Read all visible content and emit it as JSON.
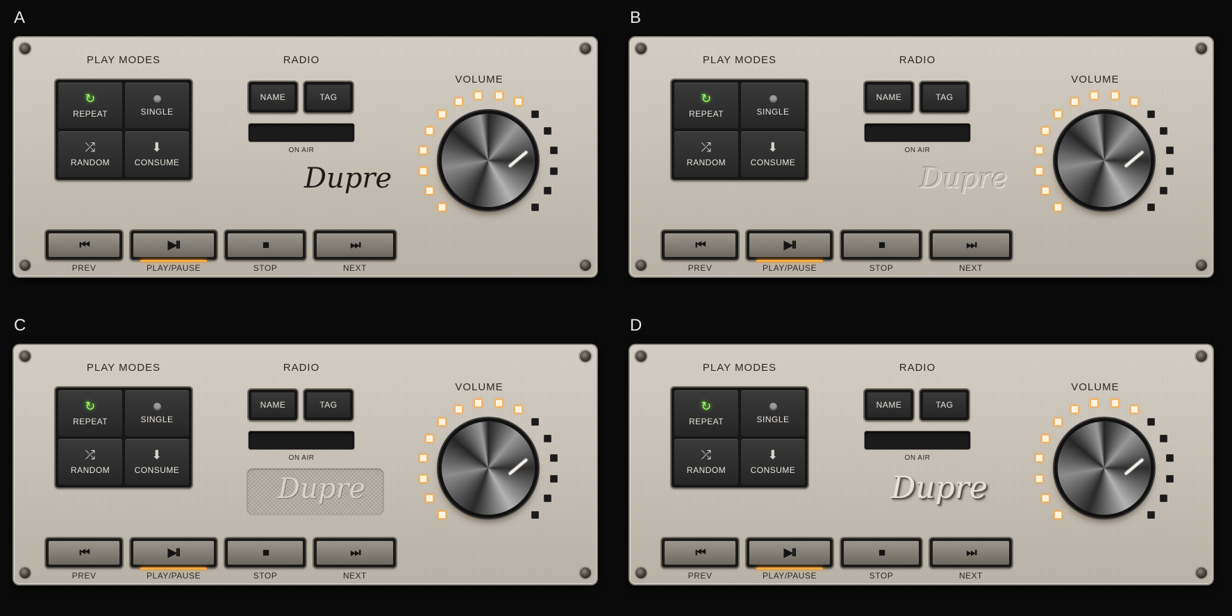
{
  "variants": [
    {
      "label": "A"
    },
    {
      "label": "B"
    },
    {
      "label": "C"
    },
    {
      "label": "D"
    }
  ],
  "play_modes": {
    "title": "PLAY MODES",
    "repeat": "REPEAT",
    "single": "SINGLE",
    "random": "RANDOM",
    "consume": "CONSUME",
    "icons": {
      "repeat": "repeat-icon",
      "single": "dot-icon",
      "random": "shuffle-icon",
      "consume": "arrow-down-icon"
    }
  },
  "radio": {
    "title": "RADIO",
    "name_label": "NAME",
    "tag_label": "TAG",
    "on_air_label": "ON AIR"
  },
  "brand": "Dupre",
  "volume": {
    "title": "VOLUME",
    "level_fraction": 0.6,
    "led_count": 16,
    "leds_on": 10
  },
  "transport": {
    "prev": "PREV",
    "play_pause": "PLAY/PAUSE",
    "stop": "STOP",
    "next": "NEXT",
    "prev_glyph": "⏮",
    "play_glyph": "▶II",
    "stop_glyph": "■",
    "next_glyph": "⏭"
  },
  "colors": {
    "repeat_active": "#9fff6a",
    "led_on": "#ffae4a",
    "play_glow": "#ffab3a",
    "panel": "#c8c1b6"
  }
}
